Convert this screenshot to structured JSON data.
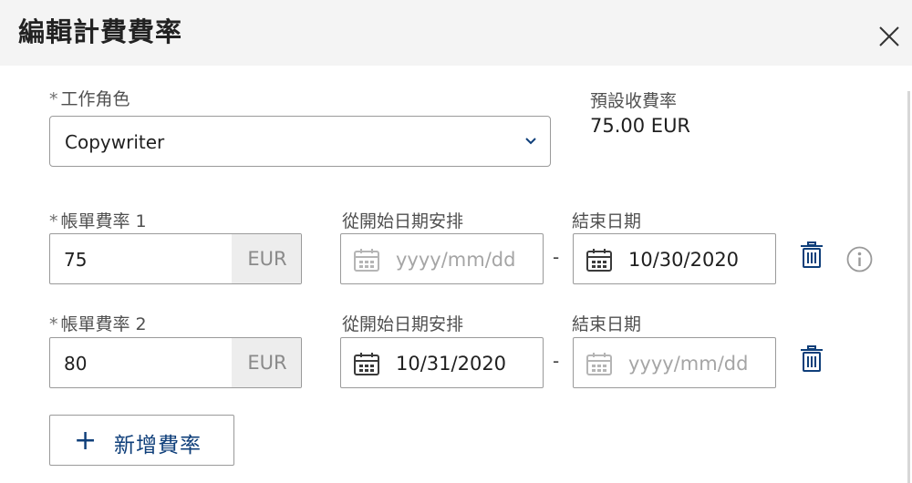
{
  "dialog": {
    "title": "編輯計費費率"
  },
  "job_role": {
    "required_mark": "*",
    "label": "工作角色",
    "value": "Copywriter"
  },
  "default_rate": {
    "label": "預設收費率",
    "value": "75.00 EUR"
  },
  "billing_rates": [
    {
      "required_mark": "*",
      "label": "帳單費率 1",
      "amount": "75",
      "currency": "EUR",
      "start_label": "從開始日期安排",
      "start_value": "",
      "start_placeholder": "yyyy/mm/dd",
      "separator": "-",
      "end_label": "結束日期",
      "end_value": "10/30/2020",
      "end_placeholder": "yyyy/mm/dd"
    },
    {
      "required_mark": "*",
      "label": "帳單費率 2",
      "amount": "80",
      "currency": "EUR",
      "start_label": "從開始日期安排",
      "start_value": "10/31/2020",
      "start_placeholder": "yyyy/mm/dd",
      "separator": "-",
      "end_label": "結束日期",
      "end_value": "",
      "end_placeholder": "yyyy/mm/dd"
    }
  ],
  "add_rate": {
    "icon": "+",
    "label": "新增費率"
  },
  "icons": {
    "close": "close-icon",
    "dropdown": "chevron-down-icon",
    "calendar": "calendar-icon",
    "delete": "trash-icon",
    "info": "info-icon"
  },
  "colors": {
    "accent": "#0f3f7a",
    "header_bg": "#f4f4f4",
    "currency_bg": "#ededed"
  }
}
